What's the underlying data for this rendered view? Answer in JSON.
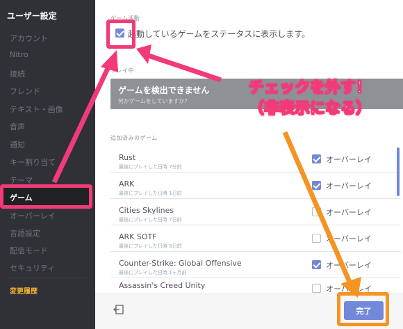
{
  "sidebar": {
    "title": "ユーザー設定",
    "items": [
      {
        "label": "アカウント",
        "active": false
      },
      {
        "label": "Nitro",
        "active": false
      },
      {
        "label": "接続",
        "active": false
      },
      {
        "label": "フレンド",
        "active": false
      },
      {
        "label": "テキスト・画像",
        "active": false
      },
      {
        "label": "音声",
        "active": false
      },
      {
        "label": "通知",
        "active": false
      },
      {
        "label": "キー割り当て",
        "active": false
      },
      {
        "label": "テーマ",
        "active": false
      },
      {
        "label": "ゲーム",
        "active": true
      },
      {
        "label": "オーバーレイ",
        "active": false
      },
      {
        "label": "言語設定",
        "active": false
      },
      {
        "label": "配信モード",
        "active": false
      },
      {
        "label": "セキュリティ",
        "active": false
      }
    ],
    "changelog": "変更履歴"
  },
  "game_activity": {
    "section_label": "ゲーム活動",
    "status_checkbox_checked": true,
    "status_text": "起動しているゲームをステータスに表示します。"
  },
  "now_playing": {
    "section_label": "プレイ中",
    "title": "ゲームを検出できません",
    "subtitle": "何かゲームをしていますか?"
  },
  "added_games": {
    "section_label": "追加済みのゲーム",
    "overlay_label": "オーバーレイ",
    "games": [
      {
        "name": "Rust",
        "last_played": "最後にプレイした日時 7分前",
        "overlay": true
      },
      {
        "name": "ARK",
        "last_played": "最後にプレイした日時 1日前",
        "overlay": true
      },
      {
        "name": "Cities Skylines",
        "last_played": "最後にプレイした日時 7日前",
        "overlay": false
      },
      {
        "name": "ARK SOTF",
        "last_played": "最後にプレイした日時 8日前",
        "overlay": false
      },
      {
        "name": "Counter-Strike: Global Offensive",
        "last_played": "最後にプレイした日時 1ヶ月前",
        "overlay": true
      },
      {
        "name": "Assassin's Creed Unity",
        "last_played": "",
        "overlay": false
      }
    ]
  },
  "footer": {
    "done_label": "完了"
  },
  "annotation": {
    "line1": "チェックを外す！",
    "line2": "（非表示になる）",
    "pink": "#f23a7a",
    "orange": "#f39423"
  },
  "colors": {
    "sidebar_bg": "#2f3136",
    "accent": "#7289da",
    "changelog": "#f0b232"
  }
}
